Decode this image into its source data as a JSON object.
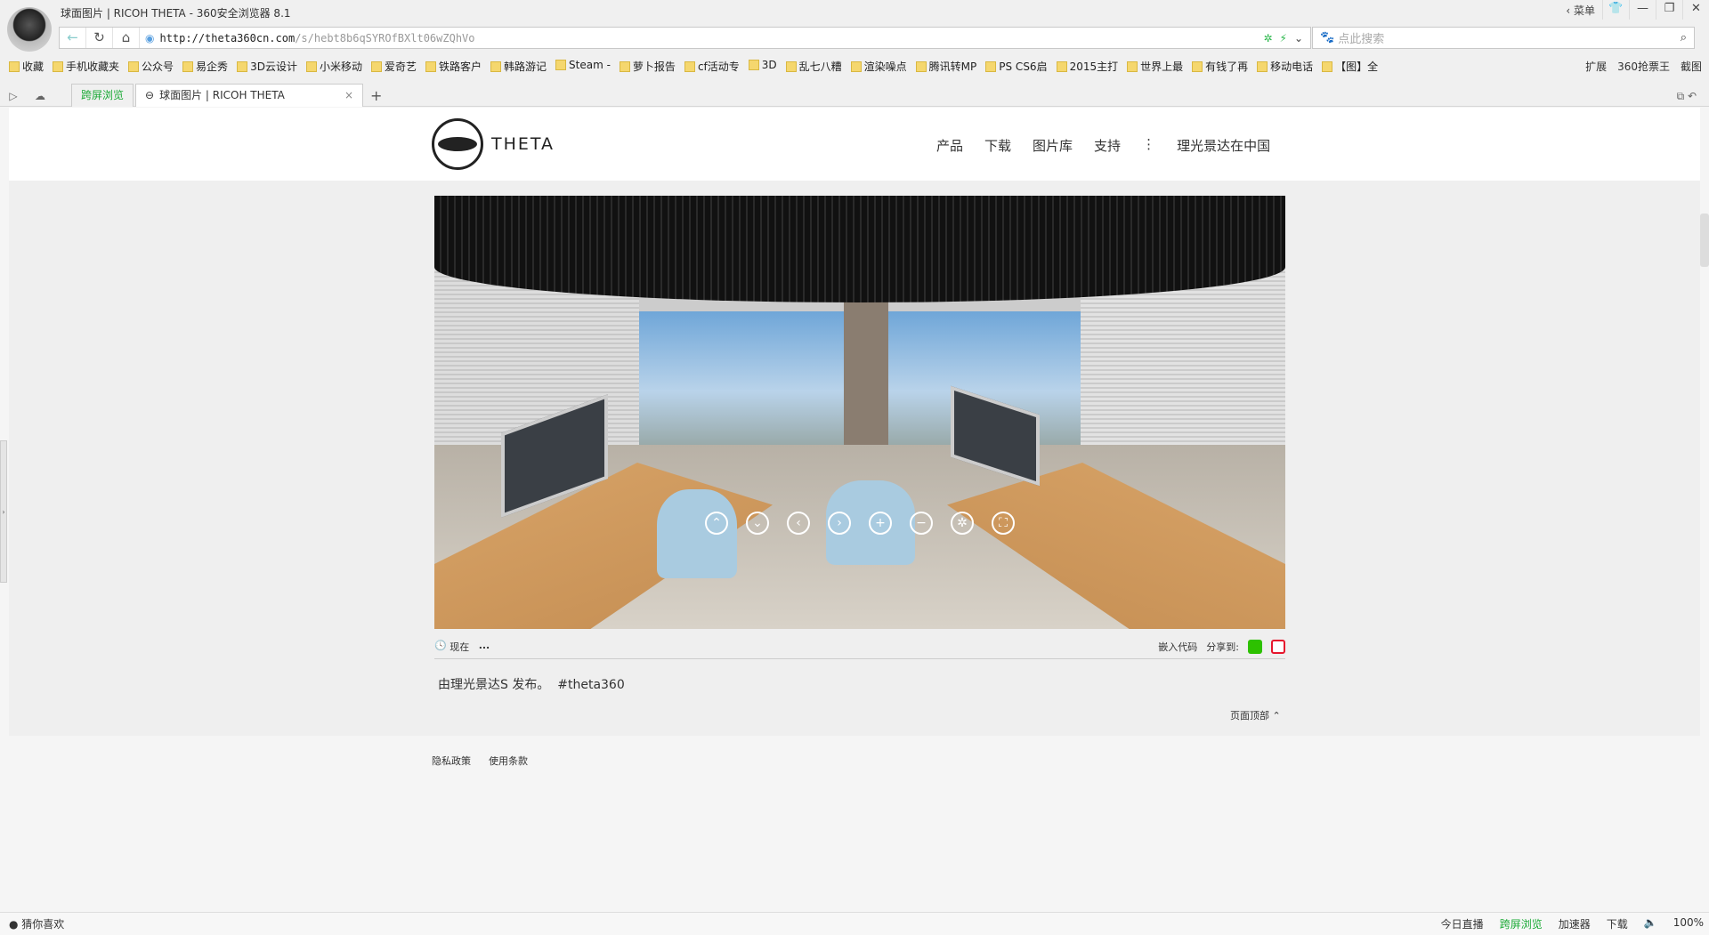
{
  "window": {
    "title": "球面图片 | RICOH THETA - 360安全浏览器 8.1",
    "menu": "菜单",
    "controls": [
      "skin",
      "minimize",
      "maximize",
      "close"
    ]
  },
  "address": {
    "url_host": "http://theta360cn.com",
    "url_path": "/s/hebt8b6qSYROfBXlt06wZQhVo",
    "search_placeholder": "点此搜索"
  },
  "bookmarks": [
    "收藏",
    "手机收藏夹",
    "公众号",
    "易企秀",
    "3D云设计",
    "小米移动",
    "爱奇艺",
    "铁路客户",
    "韩路游记",
    "Steam -",
    "萝卜报告",
    "cf活动专",
    "3D",
    "乱七八糟",
    "渲染噪点",
    "腾讯转MP",
    "PS CS6启",
    "2015主打",
    "世界上最",
    "有钱了再",
    "移动电话",
    "【图】全"
  ],
  "bookmarks_right": [
    "扩展",
    "360抢票王",
    "截图"
  ],
  "tabs": {
    "special": "跨屏浏览",
    "active": "球面图片 | RICOH THETA"
  },
  "site": {
    "brand": "THETA",
    "nav": [
      "产品",
      "下载",
      "图片库",
      "支持",
      "⋮",
      "理光景达在中国"
    ]
  },
  "photo": {
    "controls": [
      "up",
      "down",
      "left",
      "right",
      "zoom-in",
      "zoom-out",
      "auto-rotate",
      "fullscreen"
    ]
  },
  "meta": {
    "time": "现在",
    "more": "...",
    "embed": "嵌入代码",
    "share": "分享到:"
  },
  "caption": {
    "text": "由理光景达S 发布。",
    "tag": "#theta360"
  },
  "back_to_top": "页面顶部 ⌃",
  "footer": [
    "隐私政策",
    "使用条款"
  ],
  "status": {
    "left": "猜你喜欢",
    "items": [
      "今日直播",
      "跨屏浏览",
      "加速器",
      "下载"
    ],
    "zoom": "100%"
  },
  "colors": {
    "green": "#1aaa35",
    "wechat": "#2dc100",
    "weibo": "#e6162d"
  }
}
